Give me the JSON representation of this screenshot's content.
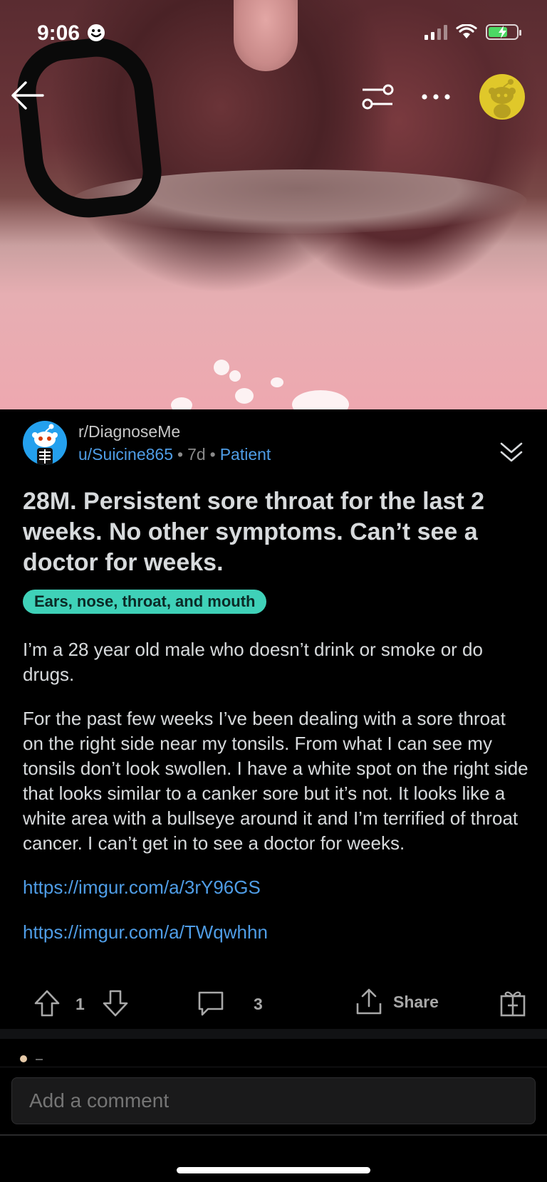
{
  "status_bar": {
    "time": "9:06",
    "battery_color": "#4cd964"
  },
  "nav": {
    "back_icon": "arrow-left-icon",
    "filter_icon": "sliders-icon",
    "more_icon": "ellipsis-icon",
    "avatar_color": "#e0c82a"
  },
  "post": {
    "subreddit": "r/DiagnoseMe",
    "author": "u/Suicine865",
    "age": "7d",
    "user_flair": "Patient",
    "title": "28M. Persistent sore throat for the last 2 weeks. No other symptoms. Can’t see a doctor for weeks.",
    "flair": "Ears, nose, throat, and mouth",
    "flair_color": "#3fd1b8",
    "body": [
      "I’m a 28 year old male who doesn’t drink or smoke or do drugs.",
      "For the past few weeks I’ve been dealing with a sore throat on the right side near my tonsils. From what I can see my tonsils don’t look swollen. I have a white spot on the right side that looks similar to a canker sore but it’s not. It looks like a white area with a bullseye around it and I’m terrified of throat cancer. I can’t get in to see a doctor for weeks."
    ],
    "links": [
      "https://imgur.com/a/3rY96GS",
      "https://imgur.com/a/TWqwhhn"
    ],
    "link_color": "#4f9de6"
  },
  "actions": {
    "vote_count": "1",
    "comment_count": "3",
    "share_label": "Share"
  },
  "comment_bar": {
    "placeholder": "Add a comment"
  }
}
